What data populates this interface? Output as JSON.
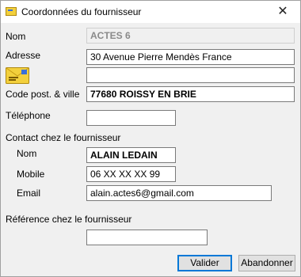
{
  "window": {
    "title": "Coordonnées du fournisseur",
    "close_glyph": "✕"
  },
  "form": {
    "nom_label": "Nom",
    "nom_value": "ACTES 6",
    "adresse_label": "Adresse",
    "adresse_line1": "30 Avenue Pierre Mendès France",
    "adresse_line2": "",
    "envelope_icon": "envelope-icon",
    "cp_label": "Code post. & ville",
    "cp_value": "77680 ROISSY EN BRIE",
    "telephone_label": "Téléphone",
    "telephone_value": "",
    "contact_heading": "Contact chez le fournisseur",
    "contact_nom_label": "Nom",
    "contact_nom_value": "ALAIN LEDAIN",
    "mobile_label": "Mobile",
    "mobile_value": "06 XX XX XX 99",
    "email_label": "Email",
    "email_value": "alain.actes6@gmail.com",
    "reference_label": "Référence chez le fournisseur",
    "reference_value": ""
  },
  "buttons": {
    "valider": "Valider",
    "abandonner": "Abandonner"
  },
  "colors": {
    "accent": "#0078d7",
    "envelope": "#f3d03c"
  }
}
